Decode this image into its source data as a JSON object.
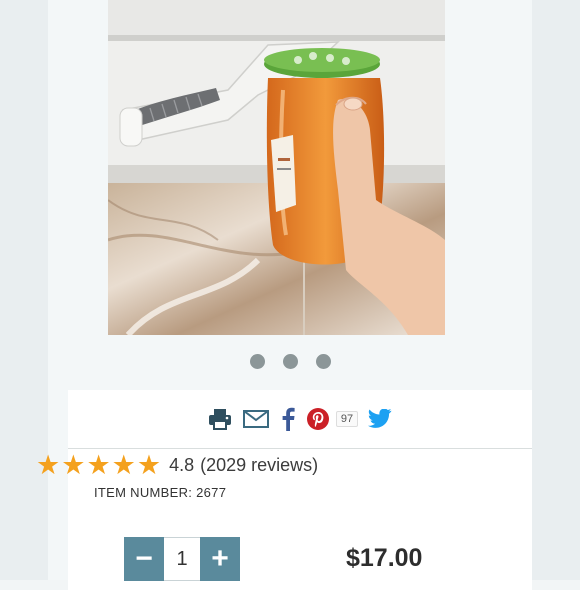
{
  "product": {
    "image_alt": "Under-cabinet jar opener with jar of jam"
  },
  "carousel": {
    "dots": 3
  },
  "share": {
    "icons": [
      "print-icon",
      "email-icon",
      "facebook-icon",
      "pinterest-icon",
      "twitter-icon"
    ],
    "pinterest_count": "97"
  },
  "rating": {
    "stars": 5,
    "score": "4.8",
    "reviews": "(2029 reviews)"
  },
  "item": {
    "label": "ITEM NUMBER: 2677"
  },
  "quantity": {
    "minus": "−",
    "value": "1",
    "plus": "+"
  },
  "price": "$17.00",
  "colors": {
    "accent": "#5a8a9c",
    "star": "#f4a11e",
    "facebook": "#3b5998",
    "pinterest": "#cb2027",
    "twitter": "#1da1f2",
    "icon_dark": "#2f4f5f"
  }
}
